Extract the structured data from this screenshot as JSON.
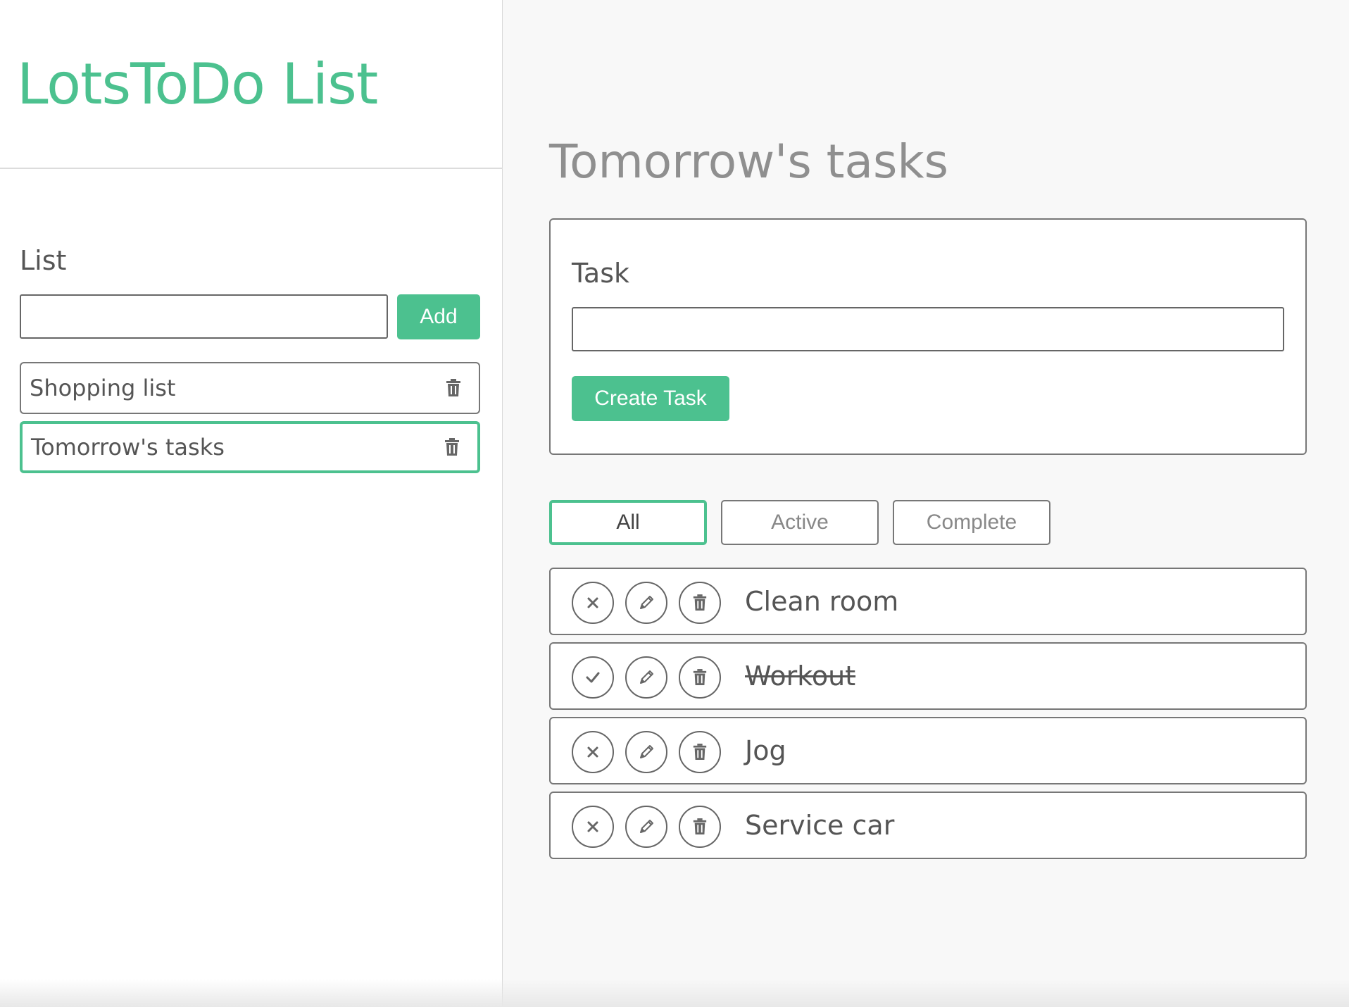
{
  "app": {
    "title": "LotsToDo List",
    "accent_color": "#4cc18f"
  },
  "sidebar": {
    "list_label": "List",
    "list_input": {
      "value": "",
      "placeholder": ""
    },
    "add_label": "Add",
    "lists": [
      {
        "name": "Shopping list",
        "active": false,
        "icon": "trash-icon"
      },
      {
        "name": "Tomorrow's tasks",
        "active": true,
        "icon": "trash-icon"
      }
    ]
  },
  "main": {
    "title": "Tomorrow's tasks",
    "task_form": {
      "label": "Task",
      "input": {
        "value": "",
        "placeholder": ""
      },
      "create_label": "Create Task"
    },
    "filters": [
      {
        "label": "All",
        "selected": true
      },
      {
        "label": "Active",
        "selected": false
      },
      {
        "label": "Complete",
        "selected": false
      }
    ],
    "tasks": [
      {
        "text": "Clean room",
        "completed": false,
        "status_icon": "x-icon"
      },
      {
        "text": "Workout",
        "completed": true,
        "status_icon": "check-icon"
      },
      {
        "text": "Jog",
        "completed": false,
        "status_icon": "x-icon"
      },
      {
        "text": "Service car",
        "completed": false,
        "status_icon": "x-icon"
      }
    ]
  }
}
